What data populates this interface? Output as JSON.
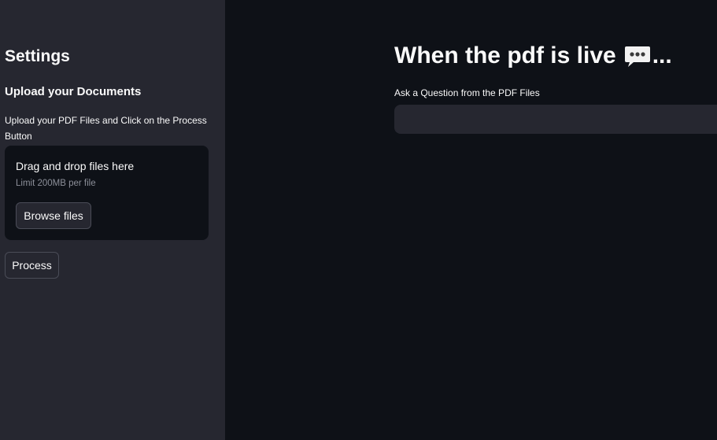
{
  "sidebar": {
    "title": "Settings",
    "upload_heading": "Upload your Documents",
    "upload_caption": "Upload your PDF Files and Click on the Process Button",
    "dropzone": {
      "title": "Drag and drop files here",
      "limit": "Limit 200MB per file",
      "browse_label": "Browse files"
    },
    "process_label": "Process"
  },
  "main": {
    "title": "When the pdf is live",
    "title_icon": "speech-bubble-icon",
    "title_suffix": "...",
    "question": {
      "label": "Ask a Question from the PDF Files",
      "value": "",
      "placeholder": ""
    }
  },
  "colors": {
    "main_background": "#0e1117",
    "sidebar_background": "#262730",
    "text": "#fafafa",
    "muted_text": "#8c8f99"
  }
}
